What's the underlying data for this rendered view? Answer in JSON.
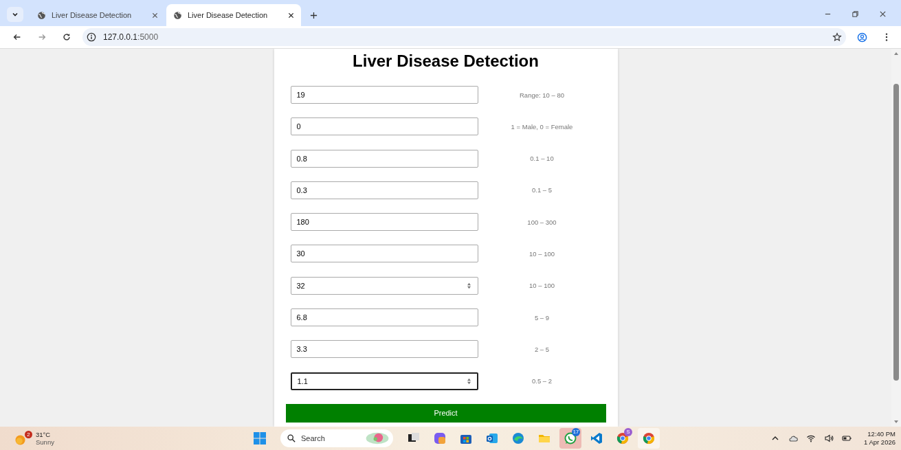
{
  "browser": {
    "tabs": [
      {
        "title": "Liver Disease Detection",
        "selected": false
      },
      {
        "title": "Liver Disease Detection",
        "selected": true
      }
    ],
    "url_host": "127.0.0.1",
    "url_port": ":5000"
  },
  "page": {
    "title": "Liver Disease Detection",
    "fields": [
      {
        "value": "19",
        "hint": "Range: 10 – 80",
        "spinner": false,
        "focused": false
      },
      {
        "value": "0",
        "hint": "1 = Male, 0 = Female",
        "spinner": false,
        "focused": false
      },
      {
        "value": "0.8",
        "hint": "0.1 – 10",
        "spinner": false,
        "focused": false
      },
      {
        "value": "0.3",
        "hint": "0.1 – 5",
        "spinner": false,
        "focused": false
      },
      {
        "value": "180",
        "hint": "100 – 300",
        "spinner": false,
        "focused": false
      },
      {
        "value": "30",
        "hint": "10 – 100",
        "spinner": false,
        "focused": false
      },
      {
        "value": "32",
        "hint": "10 – 100",
        "spinner": true,
        "focused": false
      },
      {
        "value": "6.8",
        "hint": "5 – 9",
        "spinner": false,
        "focused": false
      },
      {
        "value": "3.3",
        "hint": "2 – 5",
        "spinner": false,
        "focused": false
      },
      {
        "value": "1.1",
        "hint": "0.5 – 2",
        "spinner": true,
        "focused": true
      }
    ],
    "button": "Predict"
  },
  "taskbar": {
    "weather": {
      "badge": "2",
      "temperature": "31°C",
      "condition": "Sunny"
    },
    "search": {
      "placeholder": "Search"
    },
    "apps": [
      {
        "kind": "files"
      },
      {
        "kind": "copilot"
      },
      {
        "kind": "store"
      },
      {
        "kind": "outlook"
      },
      {
        "kind": "edge"
      },
      {
        "kind": "folder"
      },
      {
        "kind": "whatsapp",
        "badge": "17",
        "selected": true
      },
      {
        "kind": "vscode"
      },
      {
        "kind": "chrome",
        "badge": "S",
        "selected": false
      },
      {
        "kind": "chrome",
        "selected": true
      }
    ],
    "time": "12:40 PM",
    "date": "1 Apr 2026"
  }
}
